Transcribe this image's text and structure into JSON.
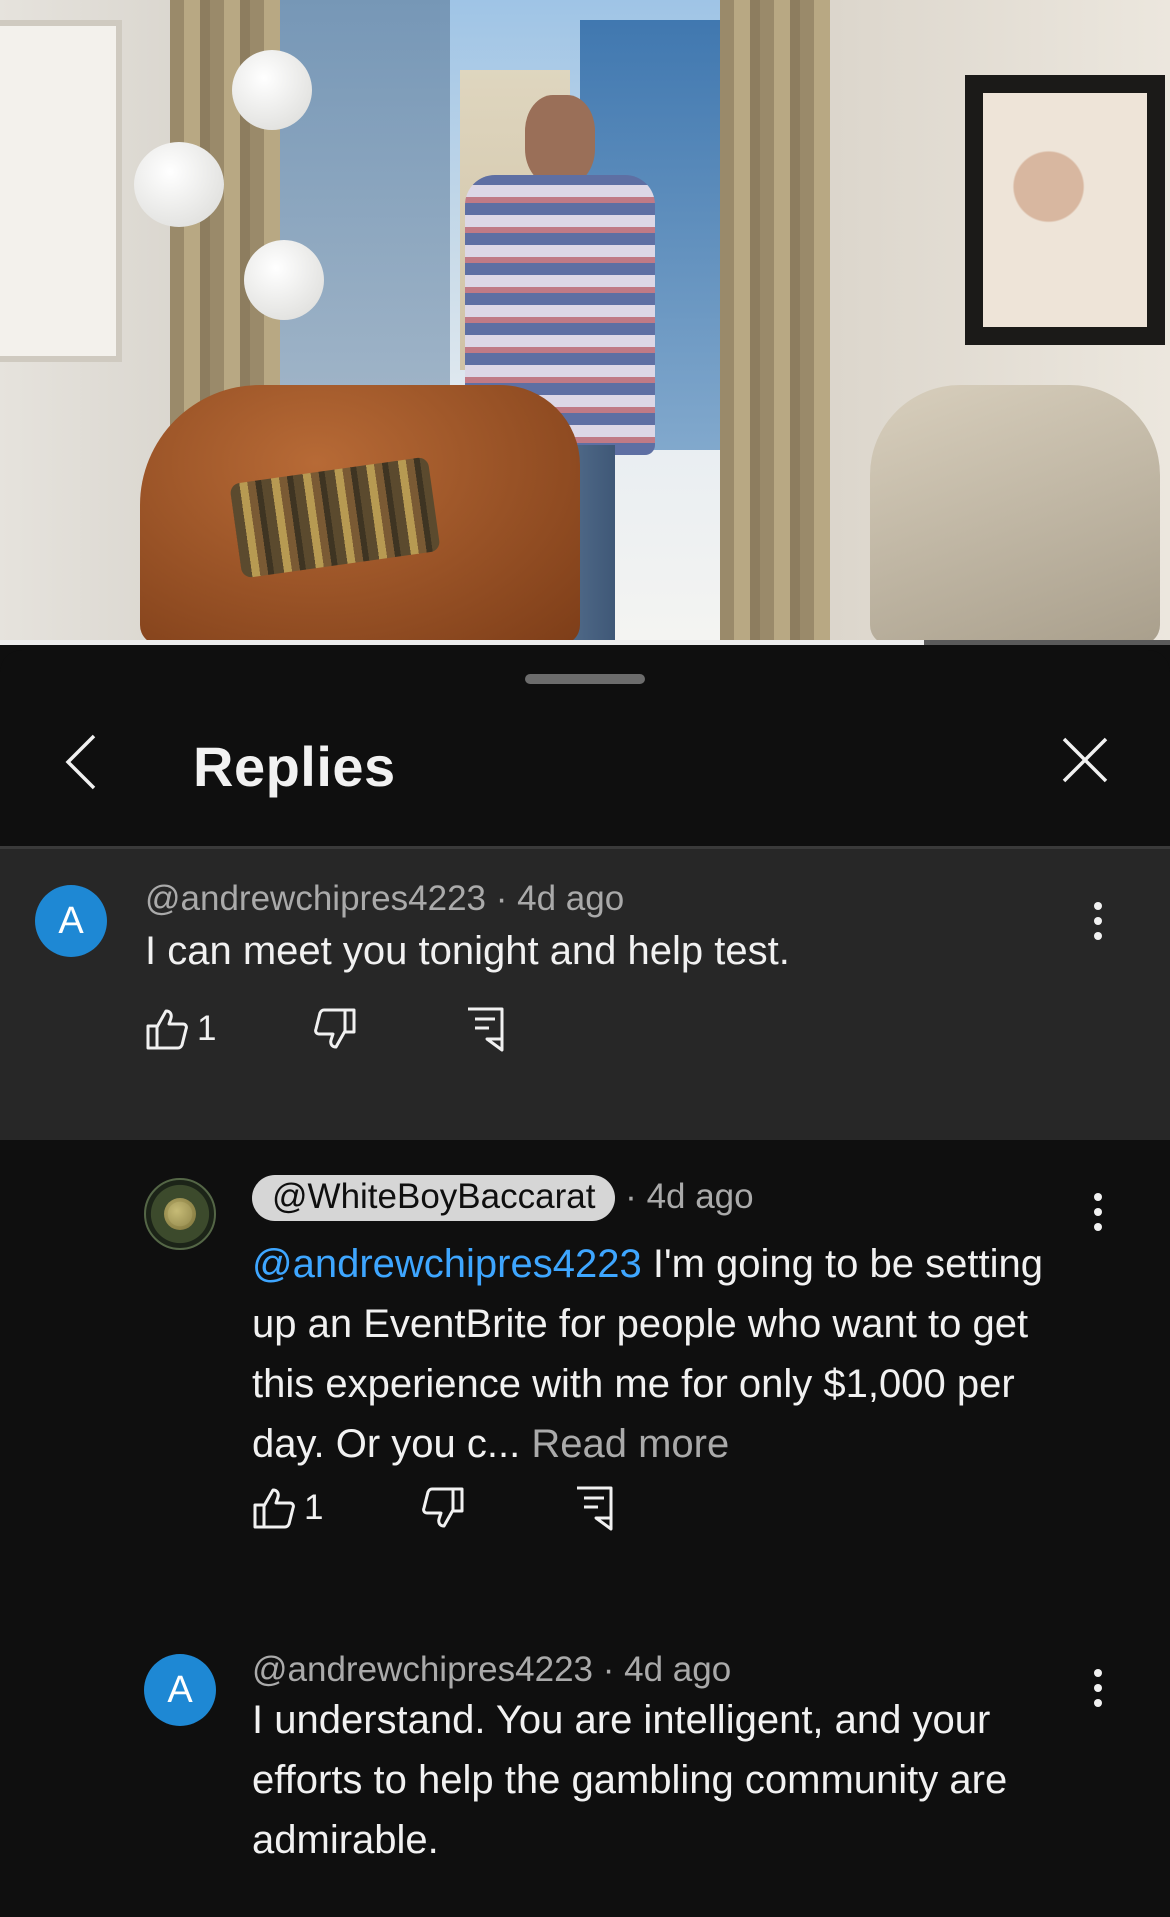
{
  "video": {
    "progress": 0.79
  },
  "header": {
    "title": "Replies"
  },
  "parent_comment": {
    "avatar_letter": "A",
    "author": "@andrewchipres4223",
    "time": "4d ago",
    "text": "I can meet you tonight and help test.",
    "likes": "1"
  },
  "replies": [
    {
      "author": "@WhiteBoyBaccarat",
      "time": "4d ago",
      "mention": "@andrewchipres4223",
      "text": " I'm going to be setting up an EventBrite for people who want to get this experience with me for only $1,000 per day. Or you c...",
      "read_more": "Read more",
      "likes": "1"
    },
    {
      "avatar_letter": "A",
      "author": "@andrewchipres4223",
      "time": "4d ago",
      "text": "I understand. You are intelligent, and your efforts to help the gambling community are admirable."
    }
  ],
  "separator": "·",
  "colors": {
    "background": "#0f0f0f",
    "parent_bg": "#272727",
    "mention": "#3ea6ff",
    "avatar": "#1e88d4"
  }
}
